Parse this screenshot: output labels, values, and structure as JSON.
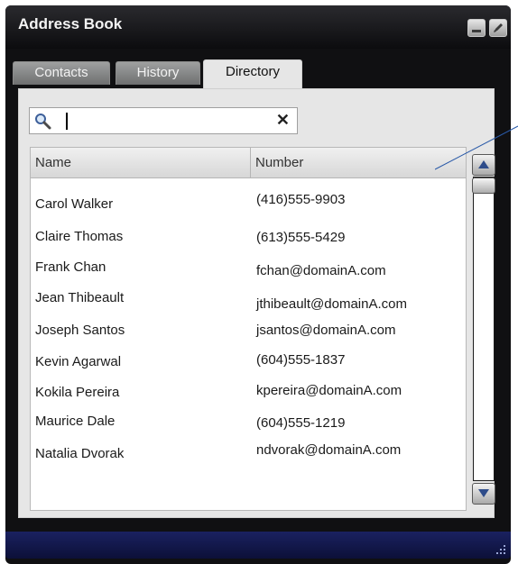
{
  "window": {
    "title": "Address Book"
  },
  "tabs": [
    {
      "label": "Contacts",
      "active": false
    },
    {
      "label": "History",
      "active": false
    },
    {
      "label": "Directory",
      "active": true
    }
  ],
  "search": {
    "value": "",
    "placeholder": "",
    "clear_symbol": "✕"
  },
  "list": {
    "columns": [
      "Name",
      "Number"
    ],
    "rows": [
      {
        "name": "Carol Walker",
        "number": "(416)555-9903"
      },
      {
        "name": "Claire Thomas",
        "number": "(613)555-5429"
      },
      {
        "name": "Frank Chan",
        "number": "fchan@domainA.com"
      },
      {
        "name": "Jean Thibeault",
        "number": "jthibeault@domainA.com"
      },
      {
        "name": "Joseph Santos",
        "number": "jsantos@domainA.com"
      },
      {
        "name": "Kevin Agarwal",
        "number": "(604)555-1837"
      },
      {
        "name": "Kokila Pereira",
        "number": "kpereira@domainA.com"
      },
      {
        "name": "Maurice Dale",
        "number": "(604)555-1219"
      },
      {
        "name": "Natalia Dvorak",
        "number": "ndvorak@domainA.com"
      }
    ]
  },
  "icons": {
    "minimize": "minimize-icon",
    "maximize": "edit-icon",
    "search": "search-icon",
    "clear": "clear-icon",
    "scroll_up": "arrow-up-icon",
    "scroll_down": "arrow-down-icon",
    "resize": "resize-grip-icon"
  },
  "colors": {
    "titlebar": "#1c1c1f",
    "panel": "#e6e6e6",
    "bottom_bar": "#141a4e",
    "callout": "#2a5aa8"
  }
}
